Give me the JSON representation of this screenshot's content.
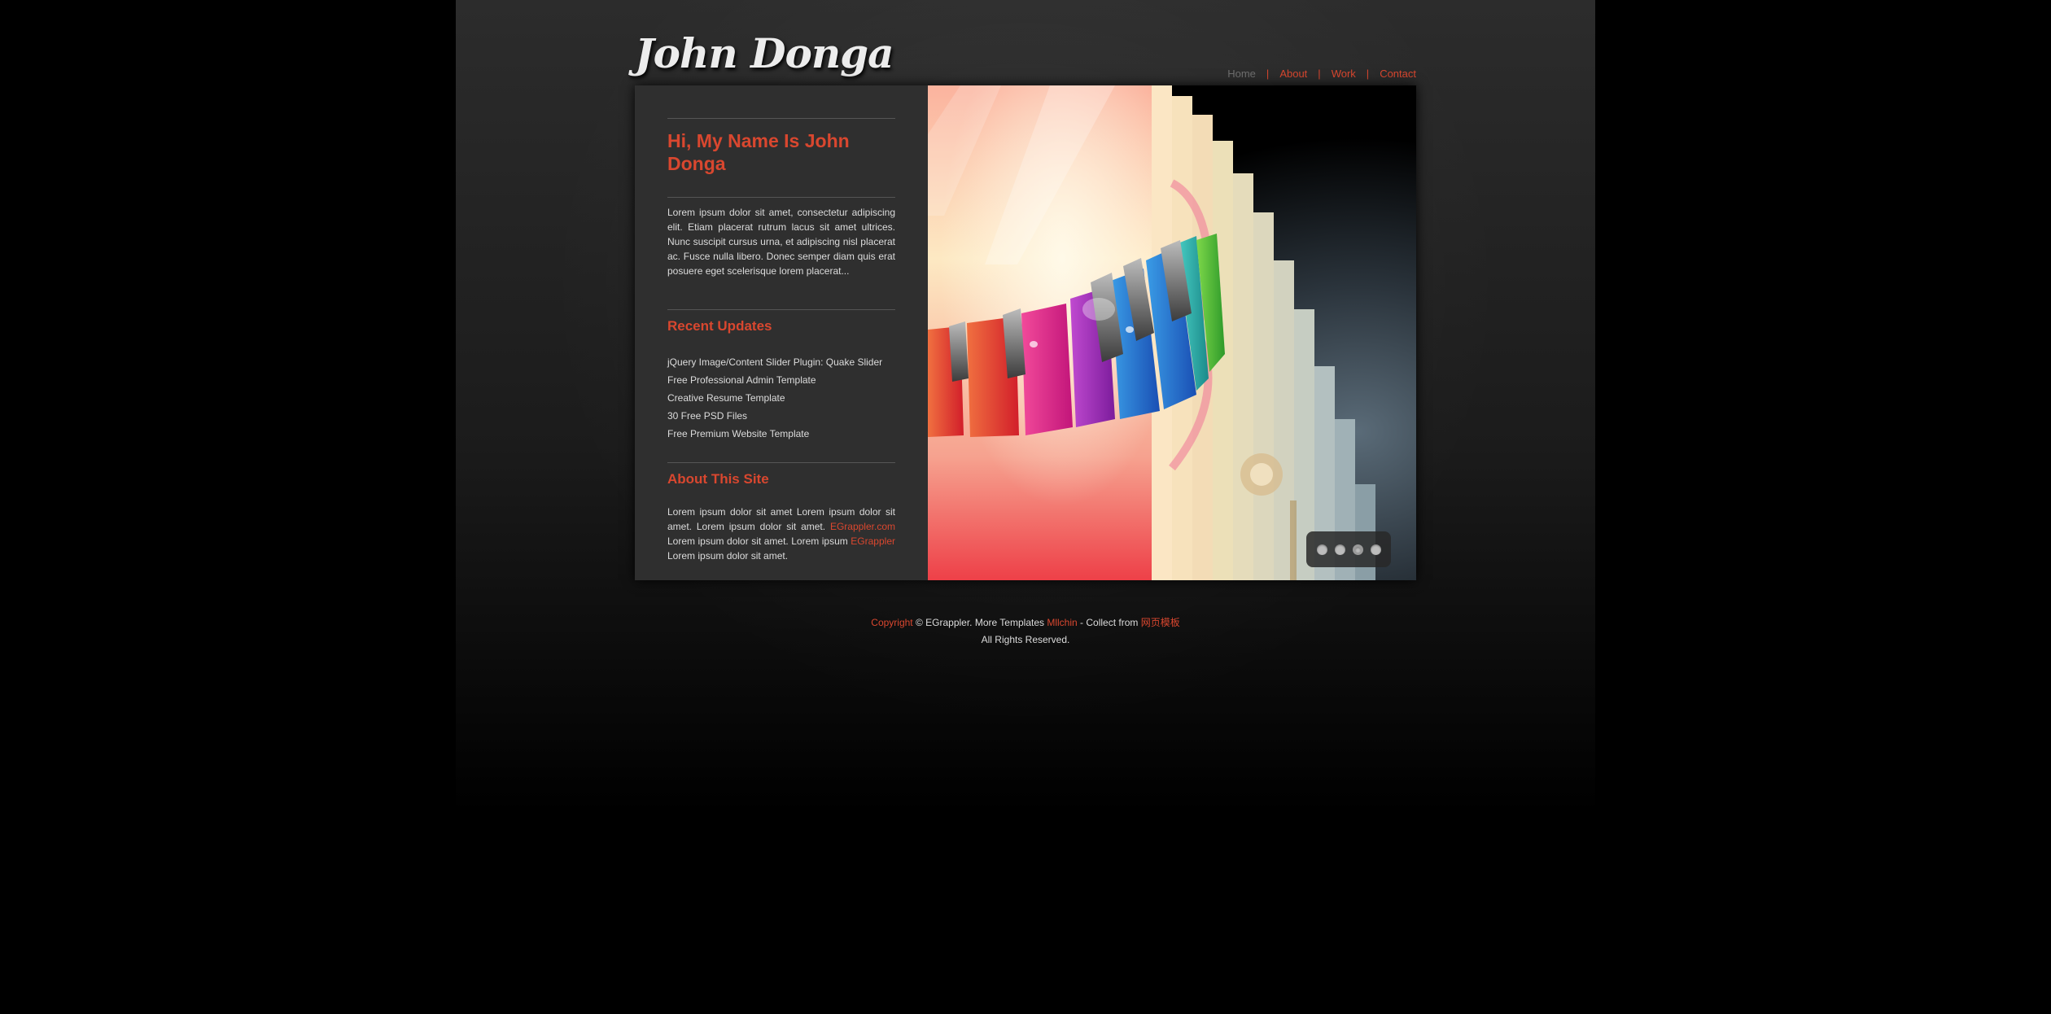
{
  "header": {
    "logo_text": "John Donga",
    "nav": [
      {
        "label": "Home",
        "active": true
      },
      {
        "label": "About",
        "active": false
      },
      {
        "label": "Work",
        "active": false
      },
      {
        "label": "Contact",
        "active": false
      }
    ],
    "nav_separator": "|"
  },
  "sidebar": {
    "heading": "Hi, My Name Is John Donga",
    "intro": "Lorem ipsum dolor sit amet, consectetur adipiscing elit. Etiam placerat rutrum lacus sit amet ultrices. Nunc suscipit cursus urna, et adipiscing nisl placerat ac. Fusce nulla libero. Donec semper diam quis erat posuere eget scelerisque lorem placerat...",
    "recent_title": "Recent Updates",
    "updates": [
      "jQuery Image/Content Slider Plugin: Quake Slider",
      "Free Professional Admin Template",
      "Creative Resume Template",
      "30 Free PSD Files",
      "Free Premium Website Template"
    ],
    "about_title": "About This Site",
    "about": {
      "part1": "Lorem ipsum dolor sit amet Lorem ipsum dolor sit amet. Lorem ipsum dolor sit amet. ",
      "link1": "EGrappler.com",
      "part2": " Lorem ipsum dolor sit amet. Lorem ipsum ",
      "link2": "EGrappler",
      "part3": " Lorem ipsum dolor sit amet."
    }
  },
  "slider": {
    "slide_count": 4,
    "active_index": 2,
    "image_icon": "piano-keys-illustration"
  },
  "footer": {
    "copyright_link": "Copyright",
    "text1": " © EGrappler. More Templates ",
    "templates_link": "Mllchin",
    "text2": " - Collect from ",
    "collect_link": "网页模板",
    "rights": "All Rights Reserved."
  },
  "colors": {
    "accent": "#d9472f",
    "sidebar_bg": "#2f2f2f",
    "page_bg": "#000000",
    "text": "#dcdcdc"
  }
}
